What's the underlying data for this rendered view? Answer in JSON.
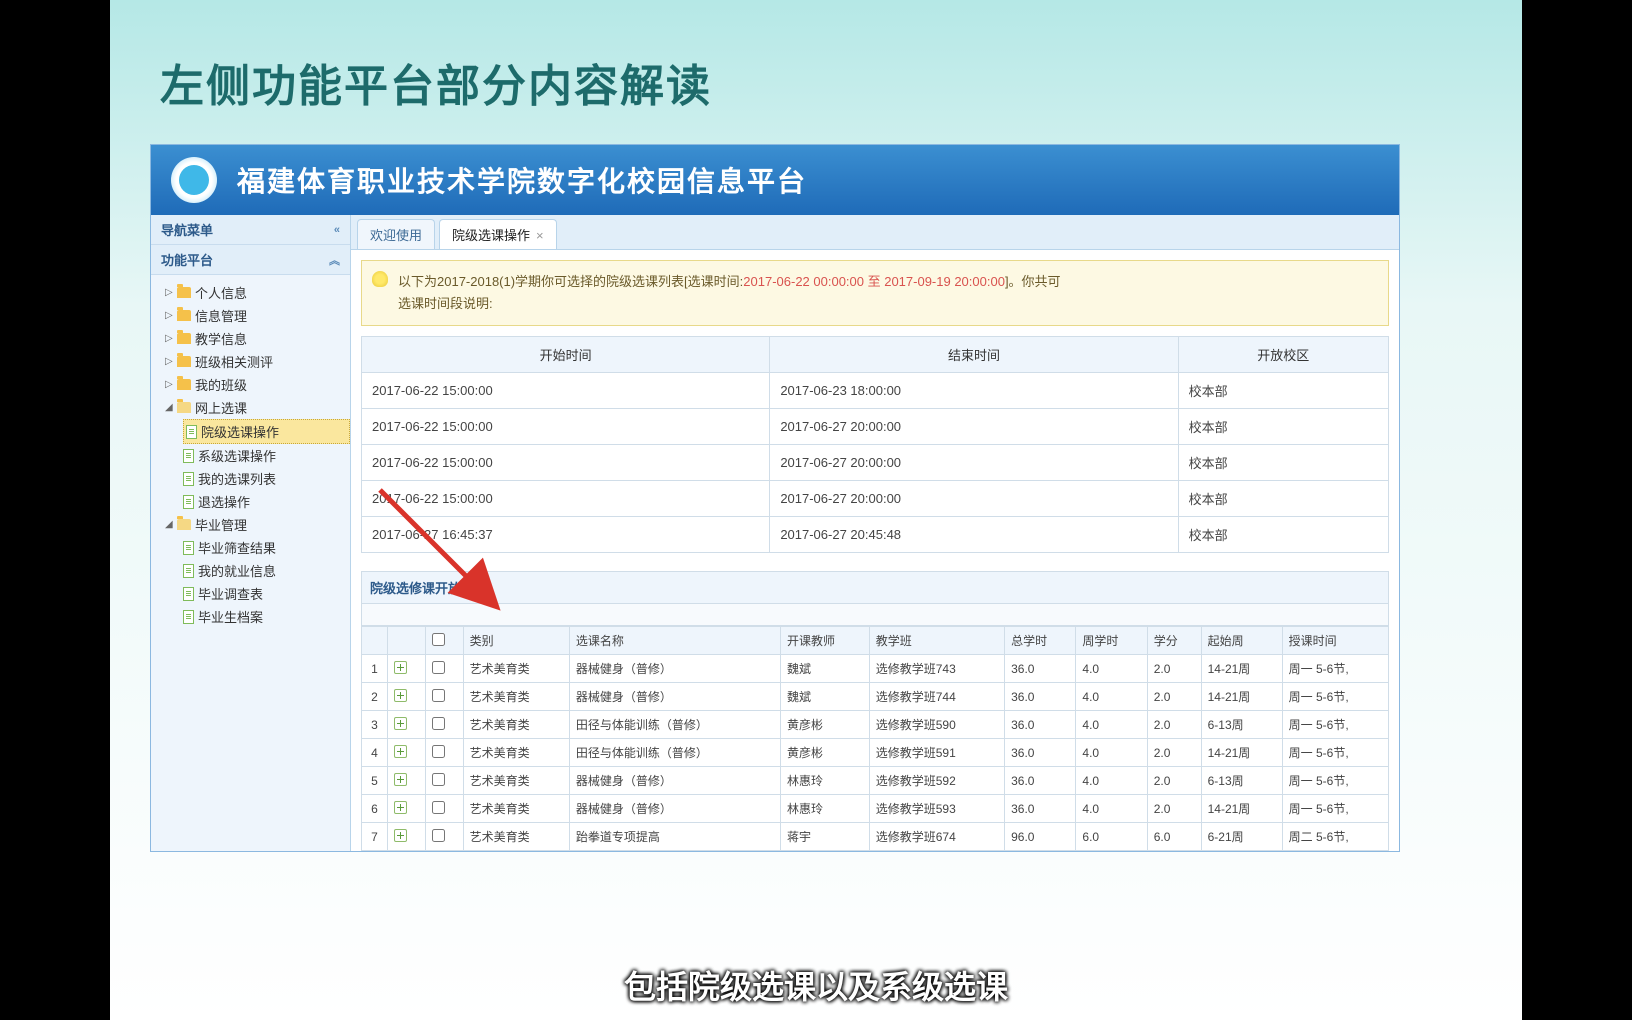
{
  "slide_title": "左侧功能平台部分内容解读",
  "app_title": "福建体育职业技术学院数字化校园信息平台",
  "sidebar": {
    "nav_title": "导航菜单",
    "platform_title": "功能平台",
    "nodes": [
      {
        "label": "个人信息"
      },
      {
        "label": "信息管理"
      },
      {
        "label": "教学信息"
      },
      {
        "label": "班级相关测评"
      },
      {
        "label": "我的班级"
      }
    ],
    "online_course": {
      "label": "网上选课",
      "children": [
        {
          "label": "院级选课操作",
          "selected": true
        },
        {
          "label": "系级选课操作"
        },
        {
          "label": "我的选课列表"
        },
        {
          "label": "退选操作"
        }
      ]
    },
    "grad": {
      "label": "毕业管理",
      "children": [
        {
          "label": "毕业筛查结果"
        },
        {
          "label": "我的就业信息"
        },
        {
          "label": "毕业调查表"
        },
        {
          "label": "毕业生档案"
        }
      ]
    }
  },
  "tabs": {
    "welcome": "欢迎使用",
    "active": "院级选课操作"
  },
  "banner": {
    "prefix": "以下为2017-2018(1)学期你可选择的院级选课列表[选课时间:",
    "highlight": "2017-06-22 00:00:00 至 2017-09-19 20:00:00",
    "suffix": "]。你共可",
    "line2": "选课时间段说明:"
  },
  "time_headers": [
    "开始时间",
    "结束时间",
    "开放校区"
  ],
  "time_rows": [
    [
      "2017-06-22 15:00:00",
      "2017-06-23 18:00:00",
      "校本部"
    ],
    [
      "2017-06-22 15:00:00",
      "2017-06-27 20:00:00",
      "校本部"
    ],
    [
      "2017-06-22 15:00:00",
      "2017-06-27 20:00:00",
      "校本部"
    ],
    [
      "2017-06-22 15:00:00",
      "2017-06-27 20:00:00",
      "校本部"
    ],
    [
      "2017-06-27 16:45:37",
      "2017-06-27 20:45:48",
      "校本部"
    ]
  ],
  "section_title": "院级选修课开放列表",
  "course_headers": [
    "",
    "",
    "",
    "类别",
    "选课名称",
    "开课教师",
    "教学班",
    "总学时",
    "周学时",
    "学分",
    "起始周",
    "授课时间"
  ],
  "course_rows": [
    [
      "1",
      "艺术美育类",
      "器械健身（普修）",
      "魏斌",
      "选修教学班743",
      "36.0",
      "4.0",
      "2.0",
      "14-21周",
      "周一 5-6节,"
    ],
    [
      "2",
      "艺术美育类",
      "器械健身（普修）",
      "魏斌",
      "选修教学班744",
      "36.0",
      "4.0",
      "2.0",
      "14-21周",
      "周一 5-6节,"
    ],
    [
      "3",
      "艺术美育类",
      "田径与体能训练（普修）",
      "黄彦彬",
      "选修教学班590",
      "36.0",
      "4.0",
      "2.0",
      "6-13周",
      "周一 5-6节,"
    ],
    [
      "4",
      "艺术美育类",
      "田径与体能训练（普修）",
      "黄彦彬",
      "选修教学班591",
      "36.0",
      "4.0",
      "2.0",
      "14-21周",
      "周一 5-6节,"
    ],
    [
      "5",
      "艺术美育类",
      "器械健身（普修）",
      "林惠玲",
      "选修教学班592",
      "36.0",
      "4.0",
      "2.0",
      "6-13周",
      "周一 5-6节,"
    ],
    [
      "6",
      "艺术美育类",
      "器械健身（普修）",
      "林惠玲",
      "选修教学班593",
      "36.0",
      "4.0",
      "2.0",
      "14-21周",
      "周一 5-6节,"
    ],
    [
      "7",
      "艺术美育类",
      "跆拳道专项提高",
      "蒋宇",
      "选修教学班674",
      "96.0",
      "6.0",
      "6.0",
      "6-21周",
      "周二 5-6节,"
    ]
  ],
  "subtitle": "包括院级选课以及系级选课"
}
